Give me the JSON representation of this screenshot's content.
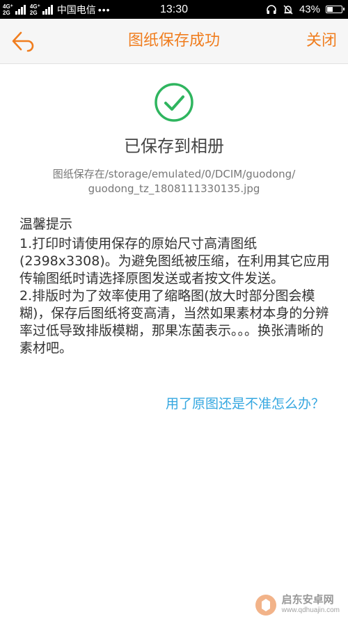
{
  "status_bar": {
    "network_top": "4G⁺",
    "network_bottom": "2G",
    "network2_top": "4G⁺",
    "network2_bottom": "2G",
    "carrier": "中国电信",
    "time": "13:30",
    "battery_text": "43%",
    "battery_level": 0.43,
    "icons": [
      "headset-icon",
      "alarm-icon"
    ]
  },
  "nav": {
    "title": "图纸保存成功",
    "close_label": "关闭",
    "back_icon": "back-arrow-icon",
    "accent_color": "#f07d1e"
  },
  "result": {
    "icon": "checkmark-circle-icon",
    "icon_color": "#2fb55f",
    "message": "已保存到相册",
    "path_line1": "图纸保存在/storage/emulated/0/DCIM/guodong/",
    "path_line2": "guodong_tz_1808111330135.jpg"
  },
  "tips": {
    "title": "温馨提示",
    "item1": "1.打印时请使用保存的原始尺寸高清图纸(2398x3308)。为避免图纸被压缩，在利用其它应用传输图纸时请选择原图发送或者按文件发送。",
    "item2": "2.排版时为了效率使用了缩略图(放大时部分图会模糊)，保存后图纸将变高清，当然如果素材本身的分辨率过低导致排版模糊，那果冻菌表示。。。换张清晰的素材吧。"
  },
  "help_link": {
    "label": "用了原图还是不准怎么办？",
    "color": "#35a7e0"
  },
  "watermark": {
    "name": "启东安卓网",
    "url": "www.qdhuajin.com"
  }
}
